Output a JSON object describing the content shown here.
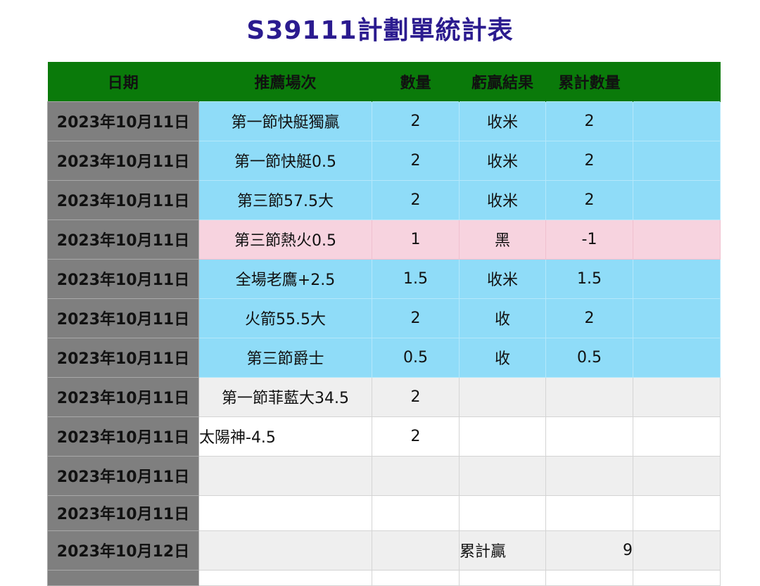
{
  "title": "S39111計劃單統計表",
  "headers": [
    "日期",
    "推薦場次",
    "數量",
    "虧贏結果",
    "累計數量",
    ""
  ],
  "rows": [
    {
      "date": "2023年10月11日",
      "match": "第一節快艇獨贏",
      "qty": "2",
      "result": "收米",
      "cum": "2",
      "extra": ""
    },
    {
      "date": "2023年10月11日",
      "match": "第一節快艇0.5",
      "qty": "2",
      "result": "收米",
      "cum": "2",
      "extra": ""
    },
    {
      "date": "2023年10月11日",
      "match": "第三節57.5大",
      "qty": "2",
      "result": "收米",
      "cum": "2",
      "extra": ""
    },
    {
      "date": "2023年10月11日",
      "match": "第三節熱火0.5",
      "qty": "1",
      "result": "黑",
      "cum": "-1",
      "extra": ""
    },
    {
      "date": "2023年10月11日",
      "match": "全場老鷹+2.5",
      "qty": "1.5",
      "result": "收米",
      "cum": "1.5",
      "extra": ""
    },
    {
      "date": "2023年10月11日",
      "match": "火箭55.5大",
      "qty": "2",
      "result": "收",
      "cum": "2",
      "extra": ""
    },
    {
      "date": "2023年10月11日",
      "match": "第三節爵士",
      "qty": "0.5",
      "result": "收",
      "cum": "0.5",
      "extra": ""
    },
    {
      "date": "2023年10月11日",
      "match": "第一節菲藍大34.5",
      "qty": "2",
      "result": "",
      "cum": "",
      "extra": ""
    },
    {
      "date": "2023年10月11日",
      "match": "太陽神-4.5",
      "qty": "2",
      "result": "",
      "cum": "",
      "extra": ""
    },
    {
      "date": "2023年10月11日",
      "match": "",
      "qty": "",
      "result": "",
      "cum": "",
      "extra": ""
    },
    {
      "date": "2023年10月11日",
      "match": "",
      "qty": "",
      "result": "",
      "cum": "",
      "extra": ""
    },
    {
      "date": "2023年10月12日",
      "match": "",
      "qty": "",
      "result": "累計贏",
      "cum": "9",
      "extra": ""
    }
  ],
  "colors": {
    "title": "#2b1b8f",
    "header": "#0a7a0a",
    "date_cell": "#7f7f7f",
    "win_row": "#8fdcf8",
    "lose_row": "#f7d3df",
    "grey_row": "#efefef"
  }
}
